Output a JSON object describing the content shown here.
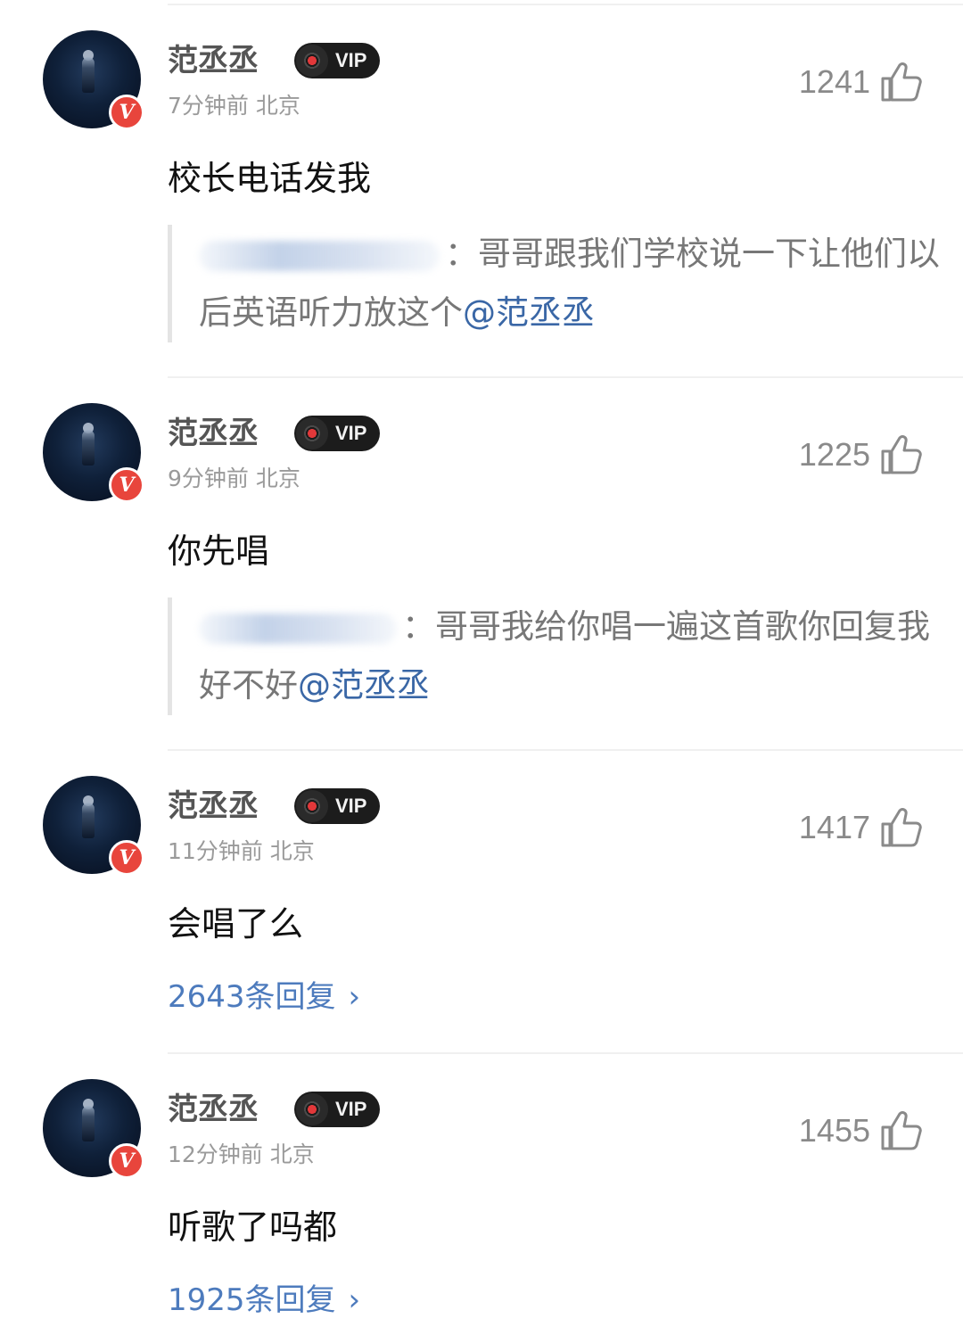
{
  "comments": [
    {
      "username": "范丞丞",
      "vip_label": "VIP",
      "time_location": "7分钟前 北京",
      "likes": "1241",
      "content": "校长电话发我",
      "quote": {
        "text": "：哥哥跟我们学校说一下让他们以后英语听力放这个",
        "mention": "@范丞丞"
      }
    },
    {
      "username": "范丞丞",
      "vip_label": "VIP",
      "time_location": "9分钟前 北京",
      "likes": "1225",
      "content": "你先唱",
      "quote": {
        "text": "：哥哥我给你唱一遍这首歌你回复我好不好",
        "mention": "@范丞丞"
      }
    },
    {
      "username": "范丞丞",
      "vip_label": "VIP",
      "time_location": "11分钟前 北京",
      "likes": "1417",
      "content": "会唱了么",
      "replies": "2643条回复"
    },
    {
      "username": "范丞丞",
      "vip_label": "VIP",
      "time_location": "12分钟前 北京",
      "likes": "1455",
      "content": "听歌了吗都",
      "replies": "1925条回复"
    }
  ],
  "icons": {
    "verified": "V",
    "like": "thumbs-up-icon",
    "chevron": "›"
  },
  "colors": {
    "verified_badge": "#e8453c",
    "mention": "#3a67a6",
    "reply_link": "#4d7bbd"
  }
}
